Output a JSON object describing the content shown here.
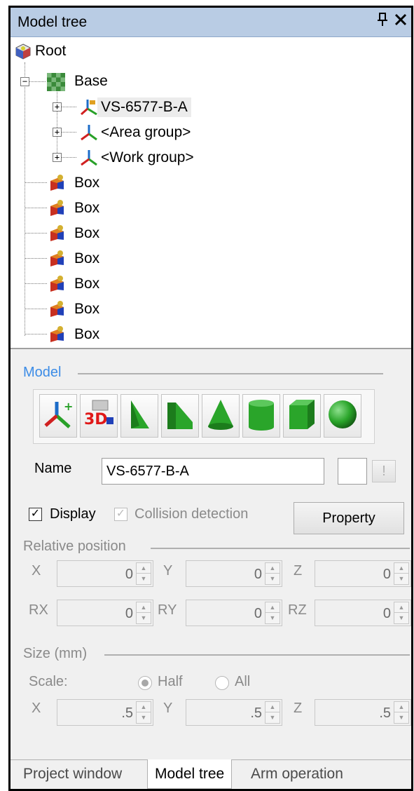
{
  "panel": {
    "title": "Model tree",
    "pin_glyph": "Ͱ",
    "close_glyph": "✕"
  },
  "tree": {
    "root": {
      "label": "Root",
      "icon": "root-cube-icon"
    },
    "base": {
      "label": "Base",
      "icon": "checker-base-icon",
      "expander": "−"
    },
    "children": [
      {
        "label": "VS-6577-B-A",
        "icon": "robot-axes-icon",
        "expander": "+",
        "selected": true
      },
      {
        "label": "<Area group>",
        "icon": "axes-icon",
        "expander": "+"
      },
      {
        "label": "<Work group>",
        "icon": "axes-icon",
        "expander": "+"
      }
    ],
    "boxes": [
      "Box",
      "Box",
      "Box",
      "Box",
      "Box",
      "Box",
      "Box"
    ]
  },
  "model": {
    "heading": "Model",
    "tools": [
      "add-frame-icon",
      "import-3d-icon",
      "triangle-prism-icon",
      "wedge-icon",
      "cone-icon",
      "cylinder-icon",
      "cube-icon",
      "sphere-icon"
    ],
    "name_label": "Name",
    "name_value": "VS-6577-B-A",
    "warn_glyph": "!",
    "display_label": "Display",
    "display_checked": true,
    "collision_label": "Collision detection",
    "collision_checked": true,
    "property_label": "Property"
  },
  "relative_position": {
    "heading": "Relative position",
    "fields": [
      {
        "label": "X",
        "value": "0"
      },
      {
        "label": "Y",
        "value": "0"
      },
      {
        "label": "Z",
        "value": "0"
      },
      {
        "label": "RX",
        "value": "0"
      },
      {
        "label": "RY",
        "value": "0"
      },
      {
        "label": "RZ",
        "value": "0"
      }
    ]
  },
  "size": {
    "heading": "Size (mm)",
    "scale_label": "Scale:",
    "half_label": "Half",
    "all_label": "All",
    "selected": "Half",
    "fields": [
      {
        "label": "X",
        "value": ".5"
      },
      {
        "label": "Y",
        "value": ".5"
      },
      {
        "label": "Z",
        "value": ".5"
      }
    ]
  },
  "tabs": [
    {
      "label": "Project window",
      "active": false
    },
    {
      "label": "Model tree",
      "active": true
    },
    {
      "label": "Arm operation",
      "active": false
    }
  ],
  "colors": {
    "title_bg": "#b9cce4",
    "section_accent": "#3c8ce6",
    "shape_green": "#2aa52a"
  }
}
